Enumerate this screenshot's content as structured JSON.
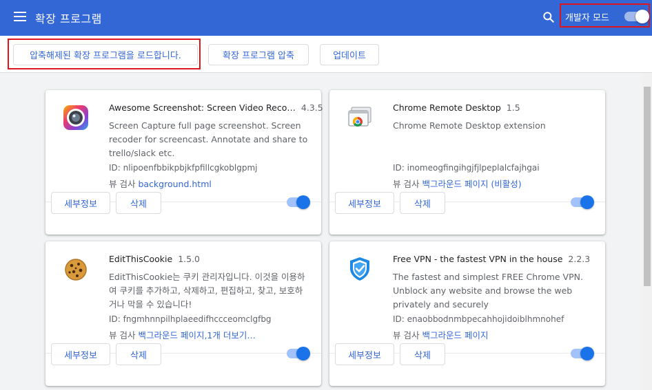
{
  "header": {
    "title": "확장 프로그램",
    "dev_mode_label": "개발자 모드",
    "dev_mode_on": true
  },
  "toolbar": {
    "load_unpacked": "압축해제된 확장 프로그램을 로드합니다.",
    "pack_extension": "확장 프로그램 압축",
    "update": "업데이트"
  },
  "extensions": [
    {
      "name": "Awesome Screenshot: Screen Video Reco…",
      "version": "4.3.5",
      "description": "Screen Capture full page screenshot. Screen recoder for screencast. Annotate and share to trello/slack etc.",
      "id": "ID: nlipoenfbbikpbjkfpfillcgkoblgpmj",
      "view_label": "뷰 검사",
      "view_link": "background.html",
      "details": "세부정보",
      "remove": "삭제",
      "enabled": true,
      "icon": "camera-lens-icon"
    },
    {
      "name": "Chrome Remote Desktop",
      "version": "1.5",
      "description": "Chrome Remote Desktop extension",
      "id": "ID: inomeogfingihgjfjlpeplalcfajhgai",
      "view_label": "뷰 검사",
      "view_link": "백그라운드 페이지 (비활성)",
      "details": "세부정보",
      "remove": "삭제",
      "enabled": true,
      "icon": "remote-desktop-icon"
    },
    {
      "name": "EditThisCookie",
      "version": "1.5.0",
      "description": "EditThisCookie는 쿠키 관리자입니다. 이것을 이용하여 쿠키를 추가하고, 삭제하고, 편집하고, 찾고, 보호하거나 막을 수 있습니다!",
      "id": "ID: fngmhnnpilhplaeedifhccceomclgfbg",
      "view_label": "뷰 검사",
      "view_link": "백그라운드 페이지,1개 더보기…",
      "details": "세부정보",
      "remove": "삭제",
      "enabled": true,
      "icon": "cookie-icon"
    },
    {
      "name": "Free VPN - the fastest VPN in the house",
      "version": "2.2.3",
      "description": "The fastest and simplest FREE Chrome VPN. Unblock any website and browse the web privately and securely",
      "id": "ID: enaobbodnmbpecahhojidoiblhmnohef",
      "view_label": "뷰 검사",
      "view_link": "백그라운드 페이지",
      "details": "세부정보",
      "remove": "삭제",
      "enabled": true,
      "icon": "shield-check-icon"
    }
  ],
  "colors": {
    "header_bg": "#3367d6",
    "accent": "#1a73e8",
    "highlight": "#e0141b"
  }
}
